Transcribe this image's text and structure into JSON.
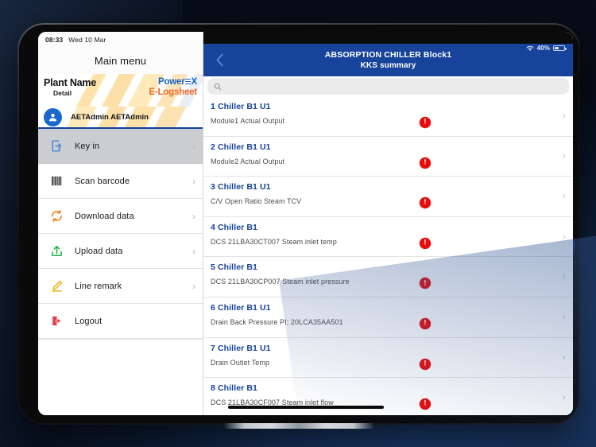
{
  "device": {
    "accent_blue": "#17439b",
    "alert_red": "#ea0c0c"
  },
  "sidebar": {
    "status_bar": {
      "time": "08:33",
      "date": "Wed 10 Mar"
    },
    "title": "Main menu",
    "brand": {
      "plant_name": "Plant Name",
      "plant_detail": "Detail",
      "logo_power_pre": "Power",
      "logo_power_post": "X",
      "logo_elogsheet": "E-Logsheet"
    },
    "user": {
      "avatar_icon": "person-icon",
      "name": "AETAdmin AETAdmin"
    },
    "items": [
      {
        "label": "Key in",
        "icon": "key-in-icon",
        "selected": true,
        "chevron": "›"
      },
      {
        "label": "Scan barcode",
        "icon": "barcode-icon",
        "selected": false,
        "chevron": "›"
      },
      {
        "label": "Download data",
        "icon": "download-sync-icon",
        "selected": false,
        "chevron": "›"
      },
      {
        "label": "Upload data",
        "icon": "upload-icon",
        "selected": false,
        "chevron": "›"
      },
      {
        "label": "Line remark",
        "icon": "pencil-icon",
        "selected": false,
        "chevron": "›"
      },
      {
        "label": "Logout",
        "icon": "logout-icon",
        "selected": false,
        "chevron": ""
      }
    ]
  },
  "main": {
    "status": {
      "wifi_icon": "wifi-icon",
      "battery_percent": "40%",
      "battery_icon": "battery-icon",
      "battery_level": 40
    },
    "nav": {
      "back_icon": "chevron-left-icon",
      "title_line1": "ABSORPTION CHILLER Block1",
      "title_line2": "KKS summary"
    },
    "search": {
      "icon": "search-icon",
      "value": "",
      "placeholder": ""
    },
    "list": [
      {
        "title": "1 Chiller B1 U1",
        "subtitle": "Module1 Actual Output",
        "alert": "!",
        "chevron": "›"
      },
      {
        "title": "2 Chiller B1 U1",
        "subtitle": "Module2 Actual Output",
        "alert": "!",
        "chevron": "›"
      },
      {
        "title": "3 Chiller B1 U1",
        "subtitle": "C/V Open Ratio Steam TCV",
        "alert": "!",
        "chevron": "›"
      },
      {
        "title": "4 Chiller B1",
        "subtitle": "DCS 21LBA30CT007 Steam inlet temp",
        "alert": "!",
        "chevron": "›"
      },
      {
        "title": "5 Chiller B1",
        "subtitle": "DCS 21LBA30CP007 Steam inlet pressure",
        "alert": "!",
        "chevron": "›"
      },
      {
        "title": "6 Chiller B1 U1",
        "subtitle": "Drain Back Pressure PI; 20LCA35AA501",
        "alert": "!",
        "chevron": "›"
      },
      {
        "title": "7 Chiller B1 U1",
        "subtitle": "Drain Outlet Temp",
        "alert": "!",
        "chevron": "›"
      },
      {
        "title": "8 Chiller B1",
        "subtitle": "DCS 21LBA30CF007 Steam inlet flow",
        "alert": "!",
        "chevron": "›"
      }
    ]
  }
}
